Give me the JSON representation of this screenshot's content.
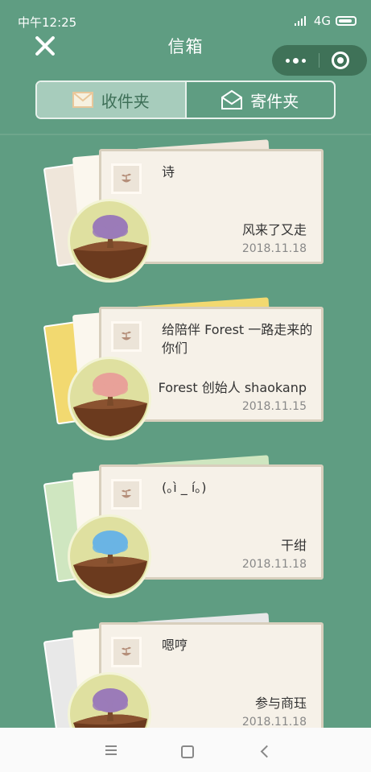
{
  "status_bar": {
    "time": "中午12:25",
    "network": "4G"
  },
  "header": {
    "title": "信箱"
  },
  "tabs": [
    {
      "label": "收件夹",
      "active": true
    },
    {
      "label": "寄件夹",
      "active": false
    }
  ],
  "letters": [
    {
      "subject": "诗",
      "sender": "风来了又走",
      "date": "2018.11.18",
      "tree_color": "#9b7bb8",
      "stack_color": "#efe6da"
    },
    {
      "subject": "给陪伴 Forest 一路走来的你们",
      "sender": "Forest 创始人 shaokanp",
      "date": "2018.11.15",
      "tree_color": "#e8a199",
      "stack_color": "#f2d970"
    },
    {
      "subject": "(｡ì _ í｡)",
      "sender": "干绀",
      "date": "2018.11.18",
      "tree_color": "#6ab4e4",
      "stack_color": "#cfe6c0"
    },
    {
      "subject": "嗯哼",
      "sender": "参与商珏",
      "date": "2018.11.18",
      "tree_color": "#9b7bb8",
      "stack_color": "#e8e8e8"
    }
  ],
  "colors": {
    "background": "#5f9d82",
    "card": "#f6f1e8",
    "tab_active": "#a7ccbc"
  }
}
